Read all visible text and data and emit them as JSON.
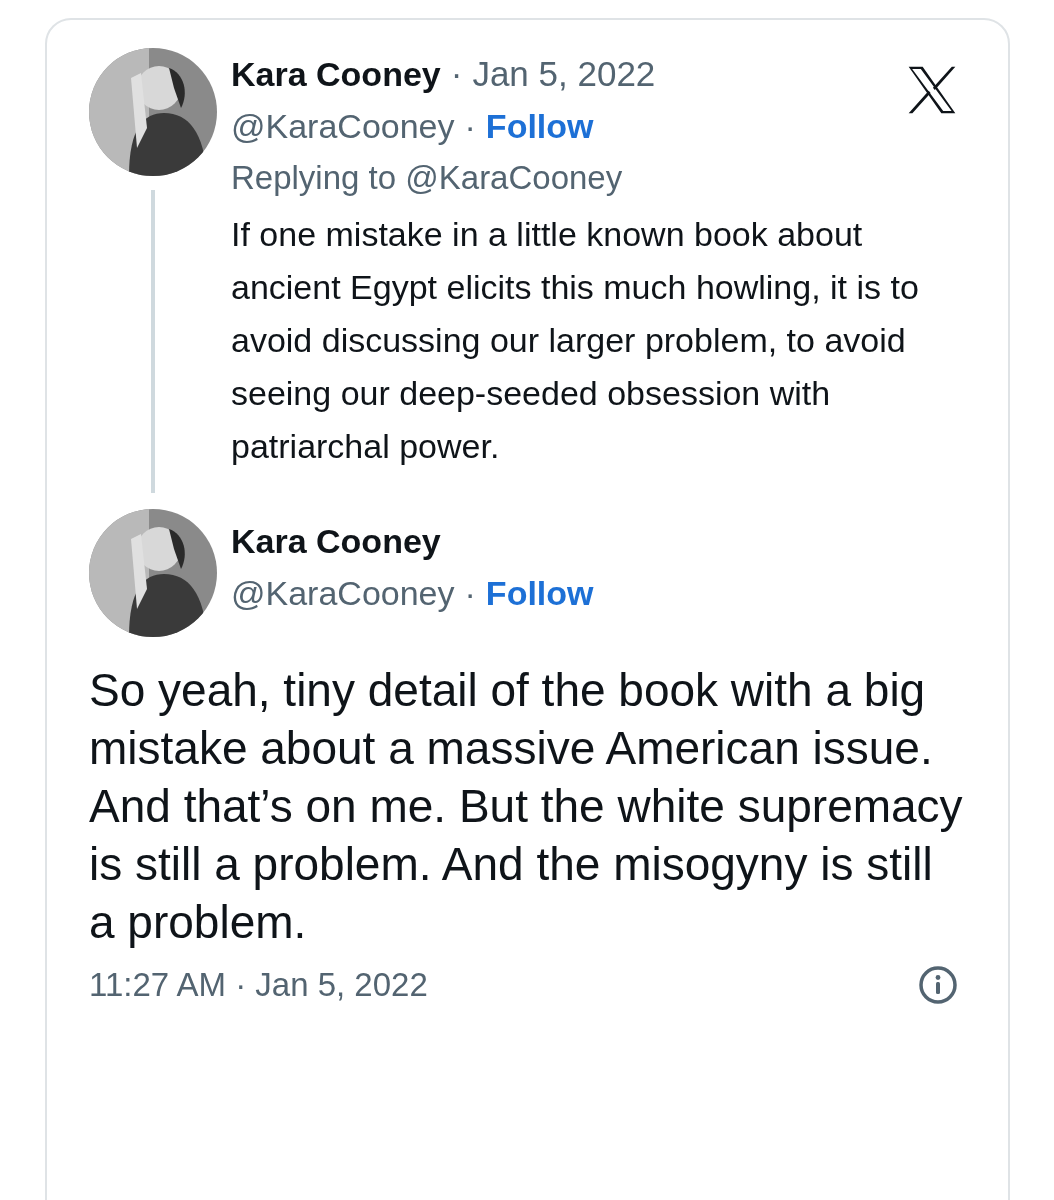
{
  "reply_tweet": {
    "name": "Kara Cooney",
    "separator_1": "·",
    "date": "Jan 5, 2022",
    "handle": "@KaraCooney",
    "separator_2": "·",
    "follow": "Follow",
    "replying_to": "Replying to @KaraCooney",
    "text": "If one mistake in a little known book about ancient Egypt elicits this much howling, it is to avoid discussing our larger problem, to avoid seeing our deep-seeded obsession with patriarchal power."
  },
  "main_tweet": {
    "name": "Kara Cooney",
    "handle": "@KaraCooney",
    "separator": "·",
    "follow": "Follow",
    "text": "So yeah, tiny detail of the book with a big mistake about a massive American issue. And that’s on me. But the white supremacy is still a problem. And the misogyny is still a problem.",
    "timestamp": "11:27 AM · Jan 5, 2022"
  }
}
